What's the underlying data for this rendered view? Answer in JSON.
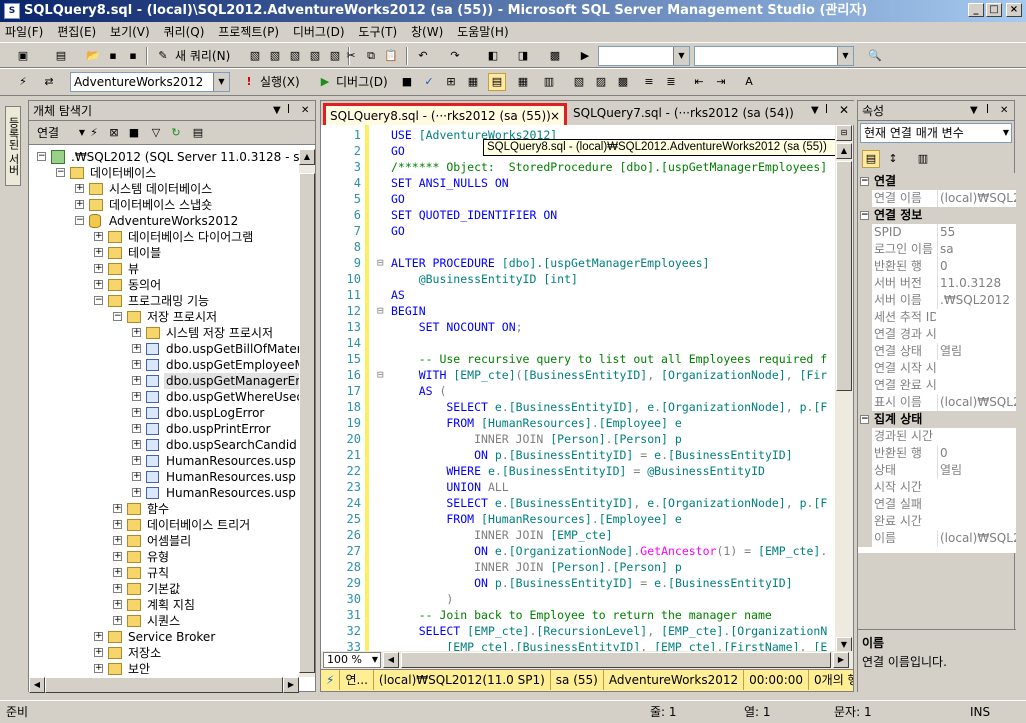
{
  "window": {
    "title": "SQLQuery8.sql - (local)\\SQL2012.AdventureWorks2012 (sa (55)) - Microsoft SQL Server Management Studio (관리자)"
  },
  "menu": [
    "파일(F)",
    "편집(E)",
    "보기(V)",
    "쿼리(Q)",
    "프로젝트(P)",
    "디버그(D)",
    "도구(T)",
    "창(W)",
    "도움말(H)"
  ],
  "toolbar1": {
    "new_query": "새 쿼리(N)"
  },
  "toolbar2": {
    "database": "AdventureWorks2012",
    "execute": "실행(X)",
    "debug": "디버그(D)"
  },
  "left_tab": "등록된 서버",
  "object_explorer": {
    "title": "개체 탐색기",
    "connect_label": "연결",
    "tree": [
      {
        "label": ".₩SQL2012 (SQL Server 11.0.3128 - sa)",
        "level": 0,
        "expander": "−",
        "icon": "server-icon"
      },
      {
        "label": "데이터베이스",
        "level": 1,
        "expander": "−",
        "icon": "folder-icon"
      },
      {
        "label": "시스템 데이터베이스",
        "level": 2,
        "expander": "+",
        "icon": "folder-icon"
      },
      {
        "label": "데이터베이스 스냅숏",
        "level": 2,
        "expander": "+",
        "icon": "folder-icon"
      },
      {
        "label": "AdventureWorks2012",
        "level": 2,
        "expander": "−",
        "icon": "database-icon"
      },
      {
        "label": "데이터베이스 다이어그램",
        "level": 3,
        "expander": "+",
        "icon": "folder-icon"
      },
      {
        "label": "테이블",
        "level": 3,
        "expander": "+",
        "icon": "folder-icon"
      },
      {
        "label": "뷰",
        "level": 3,
        "expander": "+",
        "icon": "folder-icon"
      },
      {
        "label": "동의어",
        "level": 3,
        "expander": "+",
        "icon": "folder-icon"
      },
      {
        "label": "프로그래밍 기능",
        "level": 3,
        "expander": "−",
        "icon": "folder-icon"
      },
      {
        "label": "저장 프로시저",
        "level": 4,
        "expander": "−",
        "icon": "folder-icon"
      },
      {
        "label": "시스템 저장 프로시저",
        "level": 5,
        "expander": "+",
        "icon": "folder-icon"
      },
      {
        "label": "dbo.uspGetBillOfMater",
        "level": 5,
        "expander": "+",
        "icon": "procedure-icon"
      },
      {
        "label": "dbo.uspGetEmployeeM",
        "level": 5,
        "expander": "+",
        "icon": "procedure-icon"
      },
      {
        "label": "dbo.uspGetManagerEm",
        "level": 5,
        "expander": "+",
        "icon": "procedure-icon",
        "selected": true
      },
      {
        "label": "dbo.uspGetWhereUsec",
        "level": 5,
        "expander": "+",
        "icon": "procedure-icon"
      },
      {
        "label": "dbo.uspLogError",
        "level": 5,
        "expander": "+",
        "icon": "procedure-icon"
      },
      {
        "label": "dbo.uspPrintError",
        "level": 5,
        "expander": "+",
        "icon": "procedure-icon"
      },
      {
        "label": "dbo.uspSearchCandid",
        "level": 5,
        "expander": "+",
        "icon": "procedure-icon"
      },
      {
        "label": "HumanResources.usp",
        "level": 5,
        "expander": "+",
        "icon": "procedure-icon"
      },
      {
        "label": "HumanResources.usp",
        "level": 5,
        "expander": "+",
        "icon": "procedure-icon"
      },
      {
        "label": "HumanResources.usp",
        "level": 5,
        "expander": "+",
        "icon": "procedure-icon"
      },
      {
        "label": "함수",
        "level": 4,
        "expander": "+",
        "icon": "folder-icon"
      },
      {
        "label": "데이터베이스 트리거",
        "level": 4,
        "expander": "+",
        "icon": "folder-icon"
      },
      {
        "label": "어셈블리",
        "level": 4,
        "expander": "+",
        "icon": "folder-icon"
      },
      {
        "label": "유형",
        "level": 4,
        "expander": "+",
        "icon": "folder-icon"
      },
      {
        "label": "규칙",
        "level": 4,
        "expander": "+",
        "icon": "folder-icon"
      },
      {
        "label": "기본값",
        "level": 4,
        "expander": "+",
        "icon": "folder-icon"
      },
      {
        "label": "계획 지침",
        "level": 4,
        "expander": "+",
        "icon": "folder-icon"
      },
      {
        "label": "시퀀스",
        "level": 4,
        "expander": "+",
        "icon": "folder-icon"
      },
      {
        "label": "Service Broker",
        "level": 3,
        "expander": "+",
        "icon": "folder-icon"
      },
      {
        "label": "저장소",
        "level": 3,
        "expander": "+",
        "icon": "folder-icon"
      },
      {
        "label": "보안",
        "level": 3,
        "expander": "+",
        "icon": "folder-icon"
      }
    ]
  },
  "editor": {
    "tabs": [
      "SQLQuery8.sql - (···rks2012 (sa (55))",
      "SQLQuery7.sql - (···rks2012 (sa (54))"
    ],
    "tooltip": "SQLQuery8.sql - (local)₩SQL2012.AdventureWorks2012 (sa (55))",
    "zoom": "100 %",
    "lines": [
      {
        "n": "1",
        "fold": "",
        "segs": [
          [
            "kw",
            "USE "
          ],
          [
            "id",
            "[AdventureWorks2012]"
          ]
        ]
      },
      {
        "n": "2",
        "fold": "",
        "segs": [
          [
            "kw",
            "GO"
          ]
        ]
      },
      {
        "n": "3",
        "fold": "",
        "segs": [
          [
            "cm",
            "/****** Object:  StoredProcedure [dbo].[uspGetManagerEmployees]"
          ]
        ]
      },
      {
        "n": "4",
        "fold": "",
        "segs": [
          [
            "kw",
            "SET ANSI_NULLS ON"
          ]
        ]
      },
      {
        "n": "5",
        "fold": "",
        "segs": [
          [
            "kw",
            "GO"
          ]
        ]
      },
      {
        "n": "6",
        "fold": "",
        "segs": [
          [
            "kw",
            "SET QUOTED_IDENTIFIER ON"
          ]
        ]
      },
      {
        "n": "7",
        "fold": "",
        "segs": [
          [
            "kw",
            "GO"
          ]
        ]
      },
      {
        "n": "8",
        "fold": "",
        "segs": []
      },
      {
        "n": "9",
        "fold": "⊟",
        "segs": [
          [
            "kw",
            "ALTER PROCEDURE "
          ],
          [
            "id",
            "[dbo].[uspGetManagerEmployees]"
          ]
        ]
      },
      {
        "n": "10",
        "fold": "",
        "segs": [
          [
            "id",
            "    @BusinessEntityID "
          ],
          [
            "id",
            "[int]"
          ]
        ]
      },
      {
        "n": "11",
        "fold": "",
        "segs": [
          [
            "kw",
            "AS"
          ]
        ]
      },
      {
        "n": "12",
        "fold": "⊟",
        "segs": [
          [
            "kw",
            "BEGIN"
          ]
        ]
      },
      {
        "n": "13",
        "fold": "",
        "segs": [
          [
            "kw",
            "    SET NOCOUNT ON"
          ],
          [
            "gr",
            ";"
          ]
        ]
      },
      {
        "n": "14",
        "fold": "",
        "segs": []
      },
      {
        "n": "15",
        "fold": "",
        "segs": [
          [
            "cm",
            "    -- Use recursive query to list out all Employees required f"
          ]
        ]
      },
      {
        "n": "16",
        "fold": "⊟",
        "segs": [
          [
            "kw",
            "    WITH "
          ],
          [
            "id",
            "[EMP_cte]"
          ],
          [
            "gr",
            "("
          ],
          [
            "id",
            "[BusinessEntityID]"
          ],
          [
            "gr",
            ", "
          ],
          [
            "id",
            "[OrganizationNode]"
          ],
          [
            "gr",
            ", "
          ],
          [
            "id",
            "[Fir"
          ]
        ]
      },
      {
        "n": "17",
        "fold": "",
        "segs": [
          [
            "kw",
            "    AS "
          ],
          [
            "gr",
            "("
          ]
        ]
      },
      {
        "n": "18",
        "fold": "",
        "segs": [
          [
            "kw",
            "        SELECT "
          ],
          [
            "id",
            "e"
          ],
          [
            "gr",
            "."
          ],
          [
            "id",
            "[BusinessEntityID]"
          ],
          [
            "gr",
            ", "
          ],
          [
            "id",
            "e"
          ],
          [
            "gr",
            "."
          ],
          [
            "id",
            "[OrganizationNode]"
          ],
          [
            "gr",
            ", "
          ],
          [
            "id",
            "p"
          ],
          [
            "gr",
            "."
          ],
          [
            "id",
            "[F"
          ]
        ]
      },
      {
        "n": "19",
        "fold": "",
        "segs": [
          [
            "kw",
            "        FROM "
          ],
          [
            "id",
            "[HumanResources]"
          ],
          [
            "gr",
            "."
          ],
          [
            "id",
            "[Employee] e"
          ]
        ]
      },
      {
        "n": "20",
        "fold": "",
        "segs": [
          [
            "gr",
            "            INNER JOIN "
          ],
          [
            "id",
            "[Person]"
          ],
          [
            "gr",
            "."
          ],
          [
            "id",
            "[Person] p"
          ]
        ]
      },
      {
        "n": "21",
        "fold": "",
        "segs": [
          [
            "kw",
            "            ON "
          ],
          [
            "id",
            "p"
          ],
          [
            "gr",
            "."
          ],
          [
            "id",
            "[BusinessEntityID] "
          ],
          [
            "gr",
            "= "
          ],
          [
            "id",
            "e"
          ],
          [
            "gr",
            "."
          ],
          [
            "id",
            "[BusinessEntityID]"
          ]
        ]
      },
      {
        "n": "22",
        "fold": "",
        "segs": [
          [
            "kw",
            "        WHERE "
          ],
          [
            "id",
            "e"
          ],
          [
            "gr",
            "."
          ],
          [
            "id",
            "[BusinessEntityID] "
          ],
          [
            "gr",
            "= "
          ],
          [
            "id",
            "@BusinessEntityID"
          ]
        ]
      },
      {
        "n": "23",
        "fold": "",
        "segs": [
          [
            "kw",
            "        UNION "
          ],
          [
            "gr",
            "ALL"
          ]
        ]
      },
      {
        "n": "24",
        "fold": "",
        "segs": [
          [
            "kw",
            "        SELECT "
          ],
          [
            "id",
            "e"
          ],
          [
            "gr",
            "."
          ],
          [
            "id",
            "[BusinessEntityID]"
          ],
          [
            "gr",
            ", "
          ],
          [
            "id",
            "e"
          ],
          [
            "gr",
            "."
          ],
          [
            "id",
            "[OrganizationNode]"
          ],
          [
            "gr",
            ", "
          ],
          [
            "id",
            "p"
          ],
          [
            "gr",
            "."
          ],
          [
            "id",
            "[F"
          ]
        ]
      },
      {
        "n": "25",
        "fold": "",
        "segs": [
          [
            "kw",
            "        FROM "
          ],
          [
            "id",
            "[HumanResources]"
          ],
          [
            "gr",
            "."
          ],
          [
            "id",
            "[Employee] e"
          ]
        ]
      },
      {
        "n": "26",
        "fold": "",
        "segs": [
          [
            "gr",
            "            INNER JOIN "
          ],
          [
            "id",
            "[EMP_cte]"
          ]
        ]
      },
      {
        "n": "27",
        "fold": "",
        "segs": [
          [
            "kw",
            "            ON "
          ],
          [
            "id",
            "e"
          ],
          [
            "gr",
            "."
          ],
          [
            "id",
            "[OrganizationNode]"
          ],
          [
            "gr",
            "."
          ],
          [
            "fn",
            "GetAncestor"
          ],
          [
            "gr",
            "(1) = "
          ],
          [
            "id",
            "[EMP_cte]"
          ],
          [
            "gr",
            "."
          ]
        ]
      },
      {
        "n": "28",
        "fold": "",
        "segs": [
          [
            "gr",
            "            INNER JOIN "
          ],
          [
            "id",
            "[Person]"
          ],
          [
            "gr",
            "."
          ],
          [
            "id",
            "[Person] p"
          ]
        ]
      },
      {
        "n": "29",
        "fold": "",
        "segs": [
          [
            "kw",
            "            ON "
          ],
          [
            "id",
            "p"
          ],
          [
            "gr",
            "."
          ],
          [
            "id",
            "[BusinessEntityID] "
          ],
          [
            "gr",
            "= "
          ],
          [
            "id",
            "e"
          ],
          [
            "gr",
            "."
          ],
          [
            "id",
            "[BusinessEntityID]"
          ]
        ]
      },
      {
        "n": "30",
        "fold": "",
        "segs": [
          [
            "gr",
            "        )"
          ]
        ]
      },
      {
        "n": "31",
        "fold": "",
        "segs": [
          [
            "cm",
            "    -- Join back to Employee to return the manager name"
          ]
        ]
      },
      {
        "n": "32",
        "fold": "",
        "segs": [
          [
            "kw",
            "    SELECT "
          ],
          [
            "id",
            "[EMP_cte]"
          ],
          [
            "gr",
            "."
          ],
          [
            "id",
            "[RecursionLevel]"
          ],
          [
            "gr",
            ", "
          ],
          [
            "id",
            "[EMP_cte]"
          ],
          [
            "gr",
            "."
          ],
          [
            "id",
            "[OrganizationN"
          ]
        ]
      },
      {
        "n": "33",
        "fold": "",
        "segs": [
          [
            "id",
            "        [EMP_cte]"
          ],
          [
            "gr",
            "."
          ],
          [
            "id",
            "[BusinessEntityID]"
          ],
          [
            "gr",
            ", "
          ],
          [
            "id",
            "[EMP_cte]"
          ],
          [
            "gr",
            "."
          ],
          [
            "id",
            "[FirstName]"
          ],
          [
            "gr",
            ", "
          ],
          [
            "id",
            "[E"
          ]
        ]
      }
    ],
    "status": [
      "연...",
      "(local)₩SQL2012(11.0 SP1)",
      "sa (55)",
      "AdventureWorks2012",
      "00:00:00",
      "0개의 행"
    ]
  },
  "properties": {
    "title": "속성",
    "combo": "현재 연결 매개 변수",
    "rows": [
      {
        "type": "cat",
        "name": "연결"
      },
      {
        "type": "prop",
        "name": "연결 이름",
        "value": "(local)₩SQL2"
      },
      {
        "type": "cat",
        "name": "연결 정보"
      },
      {
        "type": "prop",
        "name": "SPID",
        "value": "55"
      },
      {
        "type": "prop",
        "name": "로그인 이름",
        "value": "sa"
      },
      {
        "type": "prop",
        "name": "반환된 행",
        "value": "0"
      },
      {
        "type": "prop",
        "name": "서버 버전",
        "value": "11.0.3128"
      },
      {
        "type": "prop",
        "name": "서버 이름",
        "value": ".₩SQL2012"
      },
      {
        "type": "prop",
        "name": "세션 추적 ID",
        "value": ""
      },
      {
        "type": "prop",
        "name": "연결 경과 시간",
        "value": ""
      },
      {
        "type": "prop",
        "name": "연결 상태",
        "value": "열림"
      },
      {
        "type": "prop",
        "name": "연결 시작 시간",
        "value": ""
      },
      {
        "type": "prop",
        "name": "연결 완료 시간",
        "value": ""
      },
      {
        "type": "prop",
        "name": "표시 이름",
        "value": "(local)₩SQL2"
      },
      {
        "type": "cat",
        "name": "집계 상태"
      },
      {
        "type": "prop",
        "name": "경과된 시간",
        "value": ""
      },
      {
        "type": "prop",
        "name": "반환된 행",
        "value": "0"
      },
      {
        "type": "prop",
        "name": "상태",
        "value": "열림"
      },
      {
        "type": "prop",
        "name": "시작 시간",
        "value": ""
      },
      {
        "type": "prop",
        "name": "연결 실패",
        "value": ""
      },
      {
        "type": "prop",
        "name": "완료 시간",
        "value": ""
      },
      {
        "type": "prop",
        "name": "이름",
        "value": "(local)₩SQL2"
      }
    ],
    "desc_title": "이름",
    "desc_text": "연결 이름입니다."
  },
  "statusbar": {
    "ready": "준비",
    "line": "줄: 1",
    "col": "열: 1",
    "ch": "문자: 1",
    "ins": "INS"
  },
  "colors": {
    "highlight_border": "#e02020",
    "status_yellow": "#ffee94",
    "title_blue": "#0a246a"
  }
}
